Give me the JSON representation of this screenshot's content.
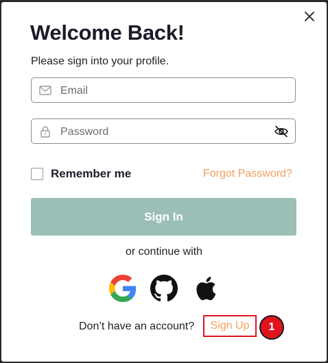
{
  "modal": {
    "title": "Welcome Back!",
    "subtitle": "Please sign into your profile.",
    "close_icon": "close-icon"
  },
  "form": {
    "email": {
      "placeholder": "Email",
      "value": "",
      "icon": "mail-icon"
    },
    "password": {
      "placeholder": "Password",
      "value": "",
      "icon": "lock-icon",
      "toggle_icon": "eye-off-icon"
    },
    "remember_label": "Remember me",
    "remember_checked": false,
    "forgot_label": "Forgot Password?",
    "signin_label": "Sign In"
  },
  "social": {
    "divider_text": "or continue with",
    "providers": [
      "google-icon",
      "github-icon",
      "apple-icon"
    ]
  },
  "footer": {
    "prompt": "Don’t have an account?",
    "signup_label": "Sign Up",
    "marker_label": "1"
  },
  "colors": {
    "accent_orange": "#f2a05a",
    "signin_button": "#9bbfb6",
    "highlight_red": "#e0141e",
    "title_text": "#1c1c28"
  }
}
